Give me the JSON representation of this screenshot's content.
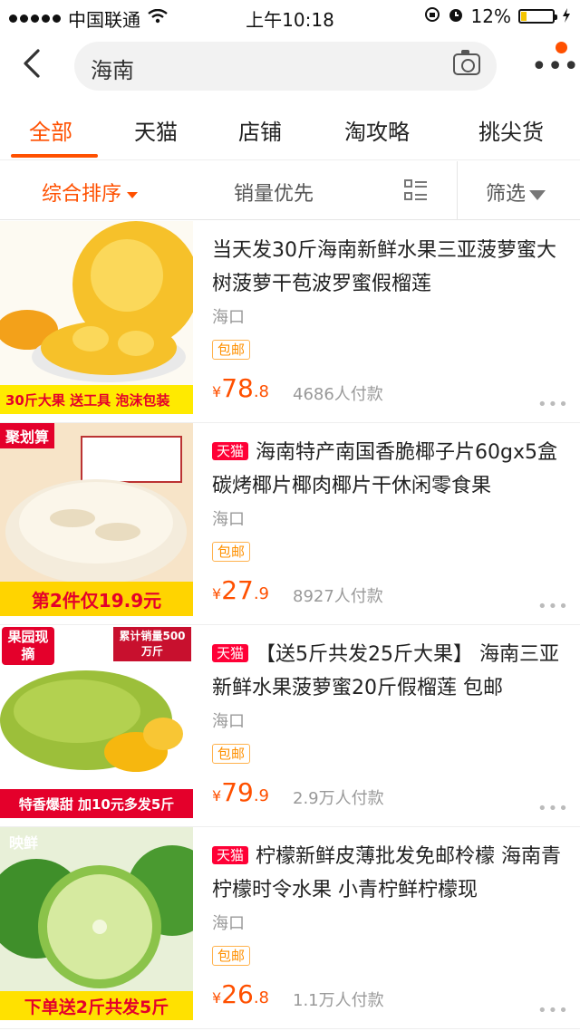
{
  "status_bar": {
    "carrier": "中国联通",
    "time": "上午10:18",
    "battery": "12%",
    "battery_level": 0.12
  },
  "search": {
    "query": "海南"
  },
  "tabs": [
    {
      "label": "全部",
      "active": true
    },
    {
      "label": "天猫"
    },
    {
      "label": "店铺"
    },
    {
      "label": "淘攻略"
    },
    {
      "label": "挑尖货"
    }
  ],
  "sort": {
    "composite": "综合排序",
    "sales": "销量优先",
    "filter": "筛选"
  },
  "products": [
    {
      "title": "当天发30斤海南新鲜水果三亚菠萝蜜大树菠萝干苞波罗蜜假榴莲",
      "tmall": false,
      "location": "海口",
      "shipping": "包邮",
      "price_int": "78",
      "price_dec": ".8",
      "sold": "4686人付款",
      "image_banner": "30斤大果 送工具 泡沫包装"
    },
    {
      "title": "海南特产南国香脆椰子片60gx5盒 碳烤椰片椰肉椰片干休闲零食果",
      "tmall": true,
      "location": "海口",
      "shipping": "包邮",
      "price_int": "27",
      "price_dec": ".9",
      "sold": "8927人付款",
      "image_tag": "聚划算",
      "image_banner": "第2件仅19.9元"
    },
    {
      "title": "【送5斤共发25斤大果】 海南三亚新鲜水果菠萝蜜20斤假榴莲 包邮",
      "tmall": true,
      "location": "海口",
      "shipping": "包邮",
      "price_int": "79",
      "price_dec": ".9",
      "sold": "2.9万人付款",
      "image_tag": "果园现摘",
      "image_tag2": "累计销量500万斤",
      "image_banner": "特香爆甜 加10元多发5斤"
    },
    {
      "title": "柠檬新鲜皮薄批发免邮柃檬 海南青柠檬时令水果 小青柠鲜柠檬现",
      "tmall": true,
      "location": "海口",
      "shipping": "包邮",
      "price_int": "26",
      "price_dec": ".8",
      "sold": "1.1万人付款",
      "image_tag": "映鲜",
      "image_banner": "下单送2斤共发5斤"
    }
  ],
  "tmall_badge": "天猫",
  "currency": "¥"
}
